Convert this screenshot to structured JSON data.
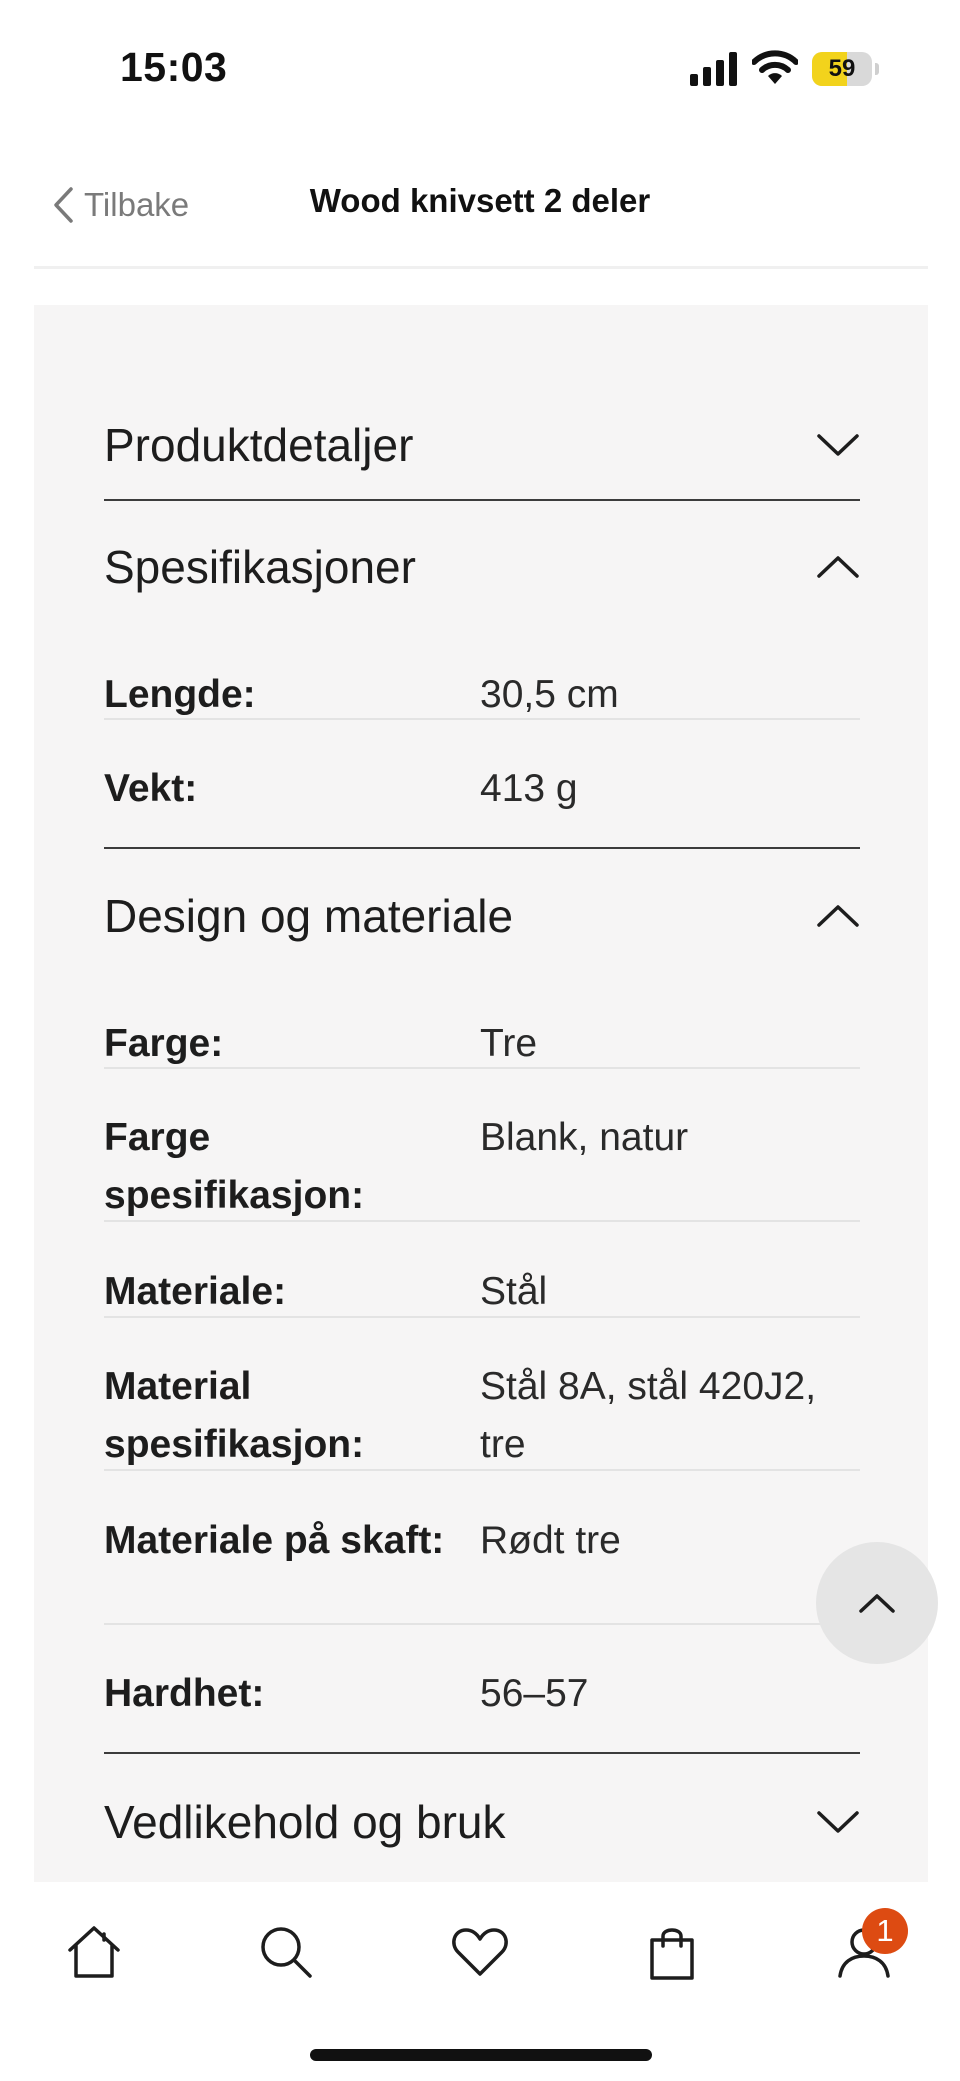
{
  "status_bar": {
    "time": "15:03",
    "battery_percent": "59",
    "battery_level": 0.59,
    "battery_color": "#f2d31c"
  },
  "header": {
    "back_label": "Tilbake",
    "title": "Wood knivsett 2 deler"
  },
  "sections": [
    {
      "title": "Produktdetaljer",
      "expanded": false,
      "chevron_icon": "chevron-down-icon"
    },
    {
      "title": "Spesifikasjoner",
      "expanded": true,
      "chevron_icon": "chevron-up-icon",
      "rows": [
        {
          "label": "Lengde:",
          "value": "30,5 cm"
        },
        {
          "label": "Vekt:",
          "value": "413 g"
        }
      ]
    },
    {
      "title": "Design og materiale",
      "expanded": true,
      "chevron_icon": "chevron-up-icon",
      "rows": [
        {
          "label": "Farge:",
          "value": "Tre"
        },
        {
          "label": "Farge spesifikasjon:",
          "value": "Blank, natur"
        },
        {
          "label": "Materiale:",
          "value": "Stål"
        },
        {
          "label": "Material spesifikasjon:",
          "value": "Stål 8A, stål 420J2, tre"
        },
        {
          "label": "Materiale på skaft:",
          "value": "Rødt tre"
        },
        {
          "label": "Hardhet:",
          "value": "56–57"
        }
      ]
    },
    {
      "title": "Vedlikehold og bruk",
      "expanded": false,
      "chevron_icon": "chevron-down-icon"
    }
  ],
  "tab_bar": {
    "items": [
      {
        "icon": "home-icon"
      },
      {
        "icon": "search-icon"
      },
      {
        "icon": "heart-icon"
      },
      {
        "icon": "shopping-bag-icon"
      },
      {
        "icon": "user-icon"
      }
    ],
    "account_badge": "1",
    "badge_color": "#dd4b12"
  }
}
